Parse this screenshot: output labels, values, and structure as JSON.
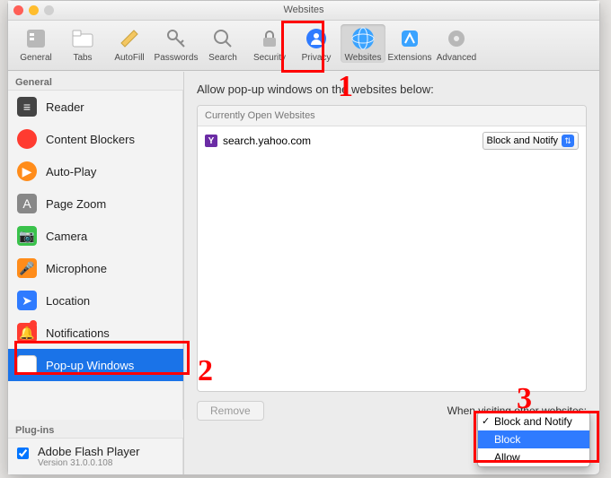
{
  "titlebar": {
    "location": "",
    "title": "Websites"
  },
  "toolbar": [
    {
      "id": "general",
      "label": "General"
    },
    {
      "id": "tabs",
      "label": "Tabs"
    },
    {
      "id": "autofill",
      "label": "AutoFill"
    },
    {
      "id": "passwords",
      "label": "Passwords"
    },
    {
      "id": "search",
      "label": "Search"
    },
    {
      "id": "security",
      "label": "Security"
    },
    {
      "id": "privacy",
      "label": "Privacy"
    },
    {
      "id": "websites",
      "label": "Websites",
      "selected": true
    },
    {
      "id": "extensions",
      "label": "Extensions"
    },
    {
      "id": "advanced",
      "label": "Advanced"
    }
  ],
  "sidebar": {
    "sectionGeneral": "General",
    "items": [
      {
        "label": "Reader"
      },
      {
        "label": "Content Blockers"
      },
      {
        "label": "Auto-Play"
      },
      {
        "label": "Page Zoom"
      },
      {
        "label": "Camera"
      },
      {
        "label": "Microphone"
      },
      {
        "label": "Location"
      },
      {
        "label": "Notifications",
        "badge": true
      },
      {
        "label": "Pop-up Windows",
        "selected": true
      }
    ],
    "sectionPlugins": "Plug-ins",
    "plugin": {
      "label": "Adobe Flash Player",
      "version": "Version 31.0.0.108",
      "checked": true
    }
  },
  "main": {
    "header": "Allow pop-up windows on the websites below:",
    "boxHeader": "Currently Open Websites",
    "site": {
      "favLetter": "Y",
      "domain": "search.yahoo.com",
      "policy": "Block and Notify"
    },
    "removeLabel": "Remove",
    "footerLabel": "When visiting other websites:",
    "dropdown": {
      "options": [
        "Block and Notify",
        "Block",
        "Allow"
      ],
      "checkedIndex": 0,
      "highlightedIndex": 1
    }
  },
  "annotations": {
    "n1": "1",
    "n2": "2",
    "n3": "3"
  }
}
